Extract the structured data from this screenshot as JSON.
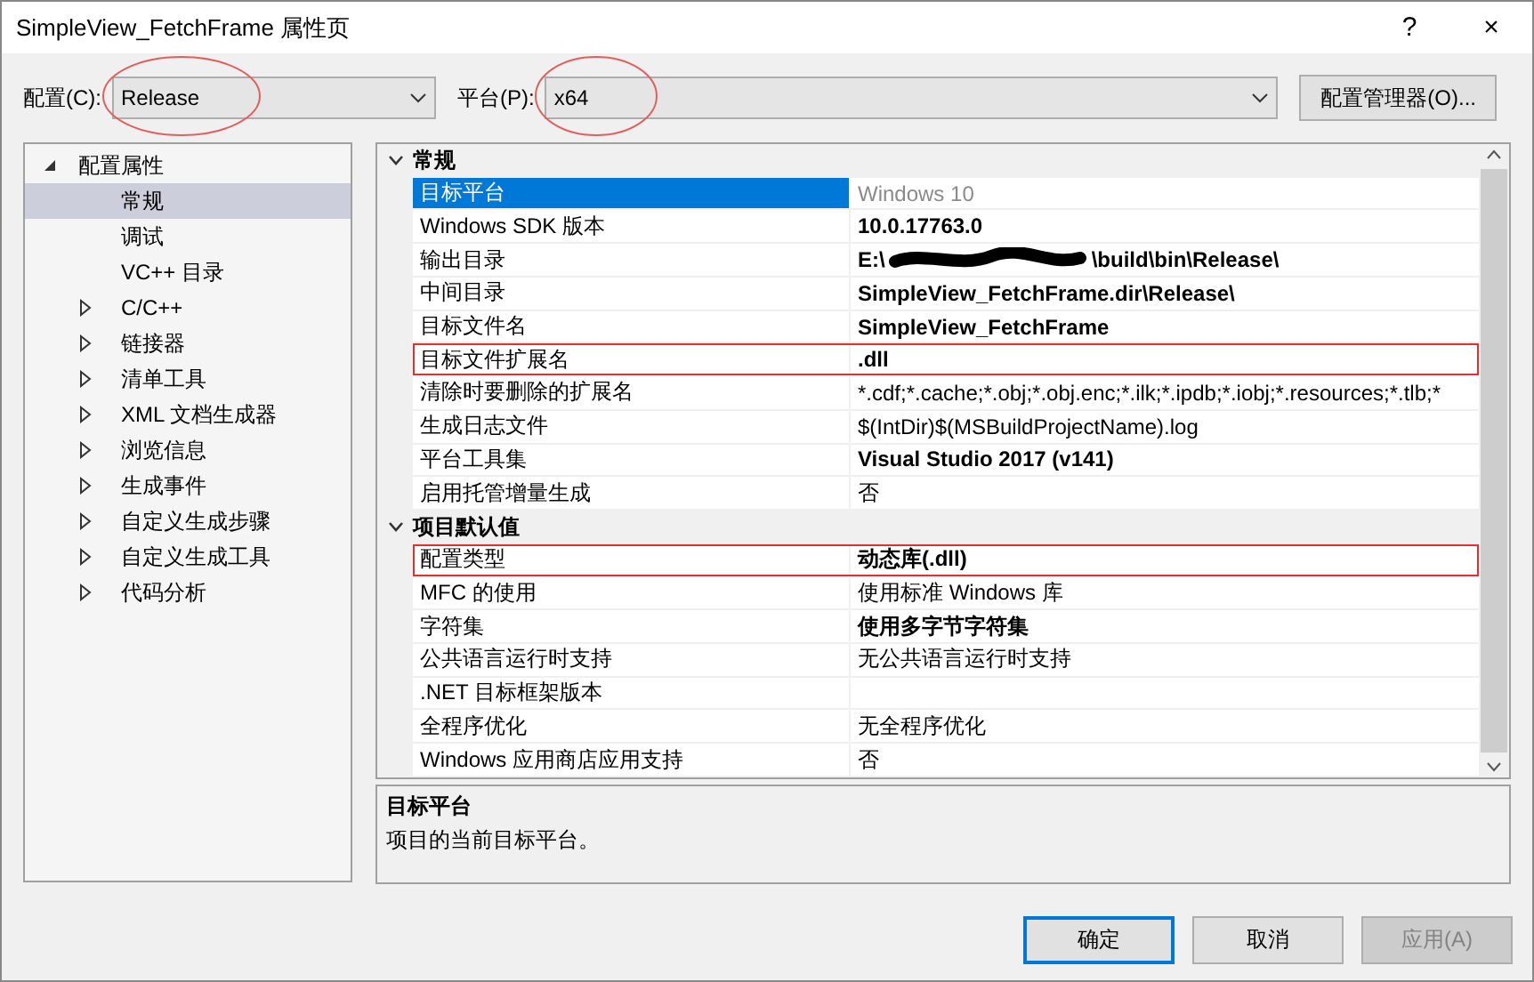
{
  "window": {
    "title": "SimpleView_FetchFrame 属性页",
    "help": "?",
    "close": "×"
  },
  "config_bar": {
    "configuration": {
      "label": "配置(C):",
      "value": "Release",
      "circled": true
    },
    "platform": {
      "label": "平台(P):",
      "value": "x64",
      "circled": true
    },
    "manager_button": "配置管理器(O)..."
  },
  "tree": [
    {
      "label": "配置属性",
      "expanded": true,
      "selected": false,
      "children": [
        {
          "label": "常规",
          "selected": true,
          "expandable": false
        },
        {
          "label": "调试",
          "selected": false,
          "expandable": false
        },
        {
          "label": "VC++ 目录",
          "selected": false,
          "expandable": false
        },
        {
          "label": "C/C++",
          "selected": false,
          "expandable": true
        },
        {
          "label": "链接器",
          "selected": false,
          "expandable": true
        },
        {
          "label": "清单工具",
          "selected": false,
          "expandable": true
        },
        {
          "label": "XML 文档生成器",
          "selected": false,
          "expandable": true
        },
        {
          "label": "浏览信息",
          "selected": false,
          "expandable": true
        },
        {
          "label": "生成事件",
          "selected": false,
          "expandable": true
        },
        {
          "label": "自定义生成步骤",
          "selected": false,
          "expandable": true
        },
        {
          "label": "自定义生成工具",
          "selected": false,
          "expandable": true
        },
        {
          "label": "代码分析",
          "selected": false,
          "expandable": true
        }
      ]
    }
  ],
  "grid": [
    {
      "category": "常规",
      "expanded": true,
      "rows": [
        {
          "name": "目标平台",
          "value": "Windows 10",
          "selected": true,
          "bold": false,
          "dimmed": true,
          "highlighted": false
        },
        {
          "name": "Windows SDK 版本",
          "value": "10.0.17763.0",
          "selected": false,
          "bold": true,
          "dimmed": false,
          "highlighted": false
        },
        {
          "name": "输出目录",
          "value": "E:\\",
          "value_end": "\\build\\bin\\Release\\",
          "redacted": true,
          "selected": false,
          "bold": true,
          "dimmed": false,
          "highlighted": false
        },
        {
          "name": "中间目录",
          "value": "SimpleView_FetchFrame.dir\\Release\\",
          "selected": false,
          "bold": true,
          "dimmed": false,
          "highlighted": false
        },
        {
          "name": "目标文件名",
          "value": "SimpleView_FetchFrame",
          "selected": false,
          "bold": true,
          "dimmed": false,
          "highlighted": false
        },
        {
          "name": "目标文件扩展名",
          "value": ".dll",
          "selected": false,
          "bold": true,
          "dimmed": false,
          "highlighted": true
        },
        {
          "name": "清除时要删除的扩展名",
          "value": "*.cdf;*.cache;*.obj;*.obj.enc;*.ilk;*.ipdb;*.iobj;*.resources;*.tlb;*",
          "selected": false,
          "bold": false,
          "dimmed": false,
          "highlighted": false
        },
        {
          "name": "生成日志文件",
          "value": "$(IntDir)$(MSBuildProjectName).log",
          "selected": false,
          "bold": false,
          "dimmed": false,
          "highlighted": false
        },
        {
          "name": "平台工具集",
          "value": "Visual Studio 2017 (v141)",
          "selected": false,
          "bold": true,
          "dimmed": false,
          "highlighted": false
        },
        {
          "name": "启用托管增量生成",
          "value": "否",
          "selected": false,
          "bold": false,
          "dimmed": false,
          "highlighted": false
        }
      ]
    },
    {
      "category": "项目默认值",
      "expanded": true,
      "rows": [
        {
          "name": "配置类型",
          "value": "动态库(.dll)",
          "selected": false,
          "bold": true,
          "dimmed": false,
          "highlighted": true
        },
        {
          "name": "MFC 的使用",
          "value": "使用标准 Windows 库",
          "selected": false,
          "bold": false,
          "dimmed": false,
          "highlighted": false
        },
        {
          "name": "字符集",
          "value": "使用多字节字符集",
          "selected": false,
          "bold": true,
          "dimmed": false,
          "highlighted": false
        },
        {
          "name": "公共语言运行时支持",
          "value": "无公共语言运行时支持",
          "selected": false,
          "bold": false,
          "dimmed": false,
          "highlighted": false
        },
        {
          "name": ".NET 目标框架版本",
          "selected": false,
          "highlighted": false
        },
        {
          "name": "全程序优化",
          "value": "无全程序优化",
          "selected": false,
          "bold": false,
          "dimmed": false,
          "highlighted": false
        },
        {
          "name": "Windows 应用商店应用支持",
          "value": "否",
          "selected": false,
          "bold": false,
          "dimmed": false,
          "highlighted": false
        }
      ]
    }
  ],
  "description": {
    "title": "目标平台",
    "text": "项目的当前目标平台。"
  },
  "buttons": [
    {
      "label": "确定",
      "default": true,
      "disabled": false
    },
    {
      "label": "取消",
      "default": false,
      "disabled": false
    },
    {
      "label": "应用(A)",
      "default": false,
      "disabled": true
    }
  ]
}
